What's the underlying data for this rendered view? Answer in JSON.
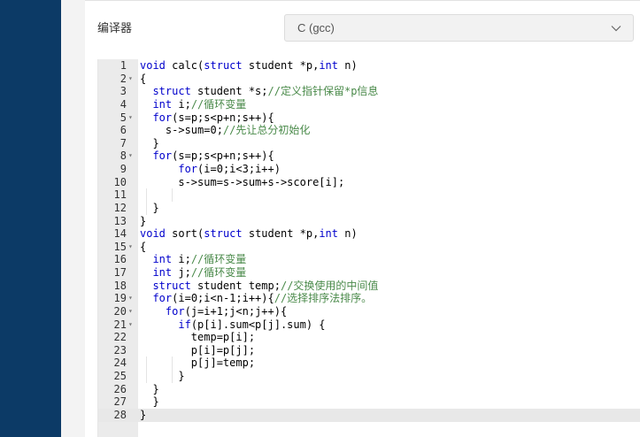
{
  "form": {
    "compiler_label": "编译器",
    "compiler_value": "C (gcc)"
  },
  "editor": {
    "active_line": 28,
    "lines": [
      {
        "n": "1",
        "fold": false,
        "segs": [
          [
            "k",
            "void"
          ],
          [
            "t",
            " calc("
          ],
          [
            "k",
            "struct"
          ],
          [
            "t",
            " student *p,"
          ],
          [
            "k",
            "int"
          ],
          [
            "t",
            " n)"
          ]
        ]
      },
      {
        "n": "2",
        "fold": true,
        "segs": [
          [
            "t",
            "{"
          ]
        ]
      },
      {
        "n": "3",
        "fold": false,
        "segs": [
          [
            "t",
            "  "
          ],
          [
            "k",
            "struct"
          ],
          [
            "t",
            " student *s;"
          ],
          [
            "c",
            "//定义指针保留*p信息"
          ]
        ]
      },
      {
        "n": "4",
        "fold": false,
        "segs": [
          [
            "t",
            "  "
          ],
          [
            "k",
            "int"
          ],
          [
            "t",
            " i;"
          ],
          [
            "c",
            "//循环变量"
          ]
        ]
      },
      {
        "n": "5",
        "fold": true,
        "segs": [
          [
            "t",
            "  "
          ],
          [
            "k",
            "for"
          ],
          [
            "t",
            "(s=p;s<p+n;s++){"
          ]
        ]
      },
      {
        "n": "6",
        "fold": false,
        "segs": [
          [
            "t",
            "    s->sum=0;"
          ],
          [
            "c",
            "//先让总分初始化"
          ]
        ]
      },
      {
        "n": "7",
        "fold": false,
        "segs": [
          [
            "t",
            "  }"
          ]
        ]
      },
      {
        "n": "8",
        "fold": true,
        "segs": [
          [
            "t",
            "  "
          ],
          [
            "k",
            "for"
          ],
          [
            "t",
            "(s=p;s<p+n;s++){"
          ]
        ]
      },
      {
        "n": "9",
        "fold": false,
        "segs": [
          [
            "t",
            "      "
          ],
          [
            "k",
            "for"
          ],
          [
            "t",
            "(i=0;i<3;i++)"
          ]
        ]
      },
      {
        "n": "10",
        "fold": false,
        "segs": [
          [
            "t",
            "      s->sum=s->sum+s->score[i];"
          ]
        ]
      },
      {
        "n": "11",
        "fold": false,
        "segs": [
          [
            "t",
            ""
          ]
        ]
      },
      {
        "n": "12",
        "fold": false,
        "segs": [
          [
            "t",
            "  }"
          ]
        ]
      },
      {
        "n": "13",
        "fold": false,
        "segs": [
          [
            "t",
            "}"
          ]
        ]
      },
      {
        "n": "14",
        "fold": false,
        "segs": [
          [
            "k",
            "void"
          ],
          [
            "t",
            " sort("
          ],
          [
            "k",
            "struct"
          ],
          [
            "t",
            " student *p,"
          ],
          [
            "k",
            "int"
          ],
          [
            "t",
            " n)"
          ]
        ]
      },
      {
        "n": "15",
        "fold": true,
        "segs": [
          [
            "t",
            "{"
          ]
        ]
      },
      {
        "n": "16",
        "fold": false,
        "segs": [
          [
            "t",
            "  "
          ],
          [
            "k",
            "int"
          ],
          [
            "t",
            " i;"
          ],
          [
            "c",
            "//循环变量"
          ]
        ]
      },
      {
        "n": "17",
        "fold": false,
        "segs": [
          [
            "t",
            "  "
          ],
          [
            "k",
            "int"
          ],
          [
            "t",
            " j;"
          ],
          [
            "c",
            "//循环变量"
          ]
        ]
      },
      {
        "n": "18",
        "fold": false,
        "segs": [
          [
            "t",
            "  "
          ],
          [
            "k",
            "struct"
          ],
          [
            "t",
            " student temp;"
          ],
          [
            "c",
            "//交换使用的中间值"
          ]
        ]
      },
      {
        "n": "19",
        "fold": true,
        "segs": [
          [
            "t",
            "  "
          ],
          [
            "k",
            "for"
          ],
          [
            "t",
            "(i=0;i<n-1;i++){"
          ],
          [
            "c",
            "//选择排序法排序。"
          ]
        ]
      },
      {
        "n": "20",
        "fold": true,
        "segs": [
          [
            "t",
            "    "
          ],
          [
            "k",
            "for"
          ],
          [
            "t",
            "(j=i+1;j<n;j++){"
          ]
        ]
      },
      {
        "n": "21",
        "fold": true,
        "segs": [
          [
            "t",
            "      "
          ],
          [
            "k",
            "if"
          ],
          [
            "t",
            "(p[i].sum<p[j].sum) {"
          ]
        ]
      },
      {
        "n": "22",
        "fold": false,
        "segs": [
          [
            "t",
            "        temp=p[i];"
          ]
        ]
      },
      {
        "n": "23",
        "fold": false,
        "segs": [
          [
            "t",
            "        p[i]=p[j];"
          ]
        ]
      },
      {
        "n": "24",
        "fold": false,
        "segs": [
          [
            "t",
            "        p[j]=temp;"
          ]
        ]
      },
      {
        "n": "25",
        "fold": false,
        "segs": [
          [
            "t",
            "      }"
          ]
        ]
      },
      {
        "n": "26",
        "fold": false,
        "segs": [
          [
            "t",
            "  }"
          ]
        ]
      },
      {
        "n": "27",
        "fold": false,
        "segs": [
          [
            "t",
            "  }"
          ]
        ]
      },
      {
        "n": "28",
        "fold": false,
        "segs": [
          [
            "t",
            "}"
          ]
        ]
      }
    ]
  }
}
